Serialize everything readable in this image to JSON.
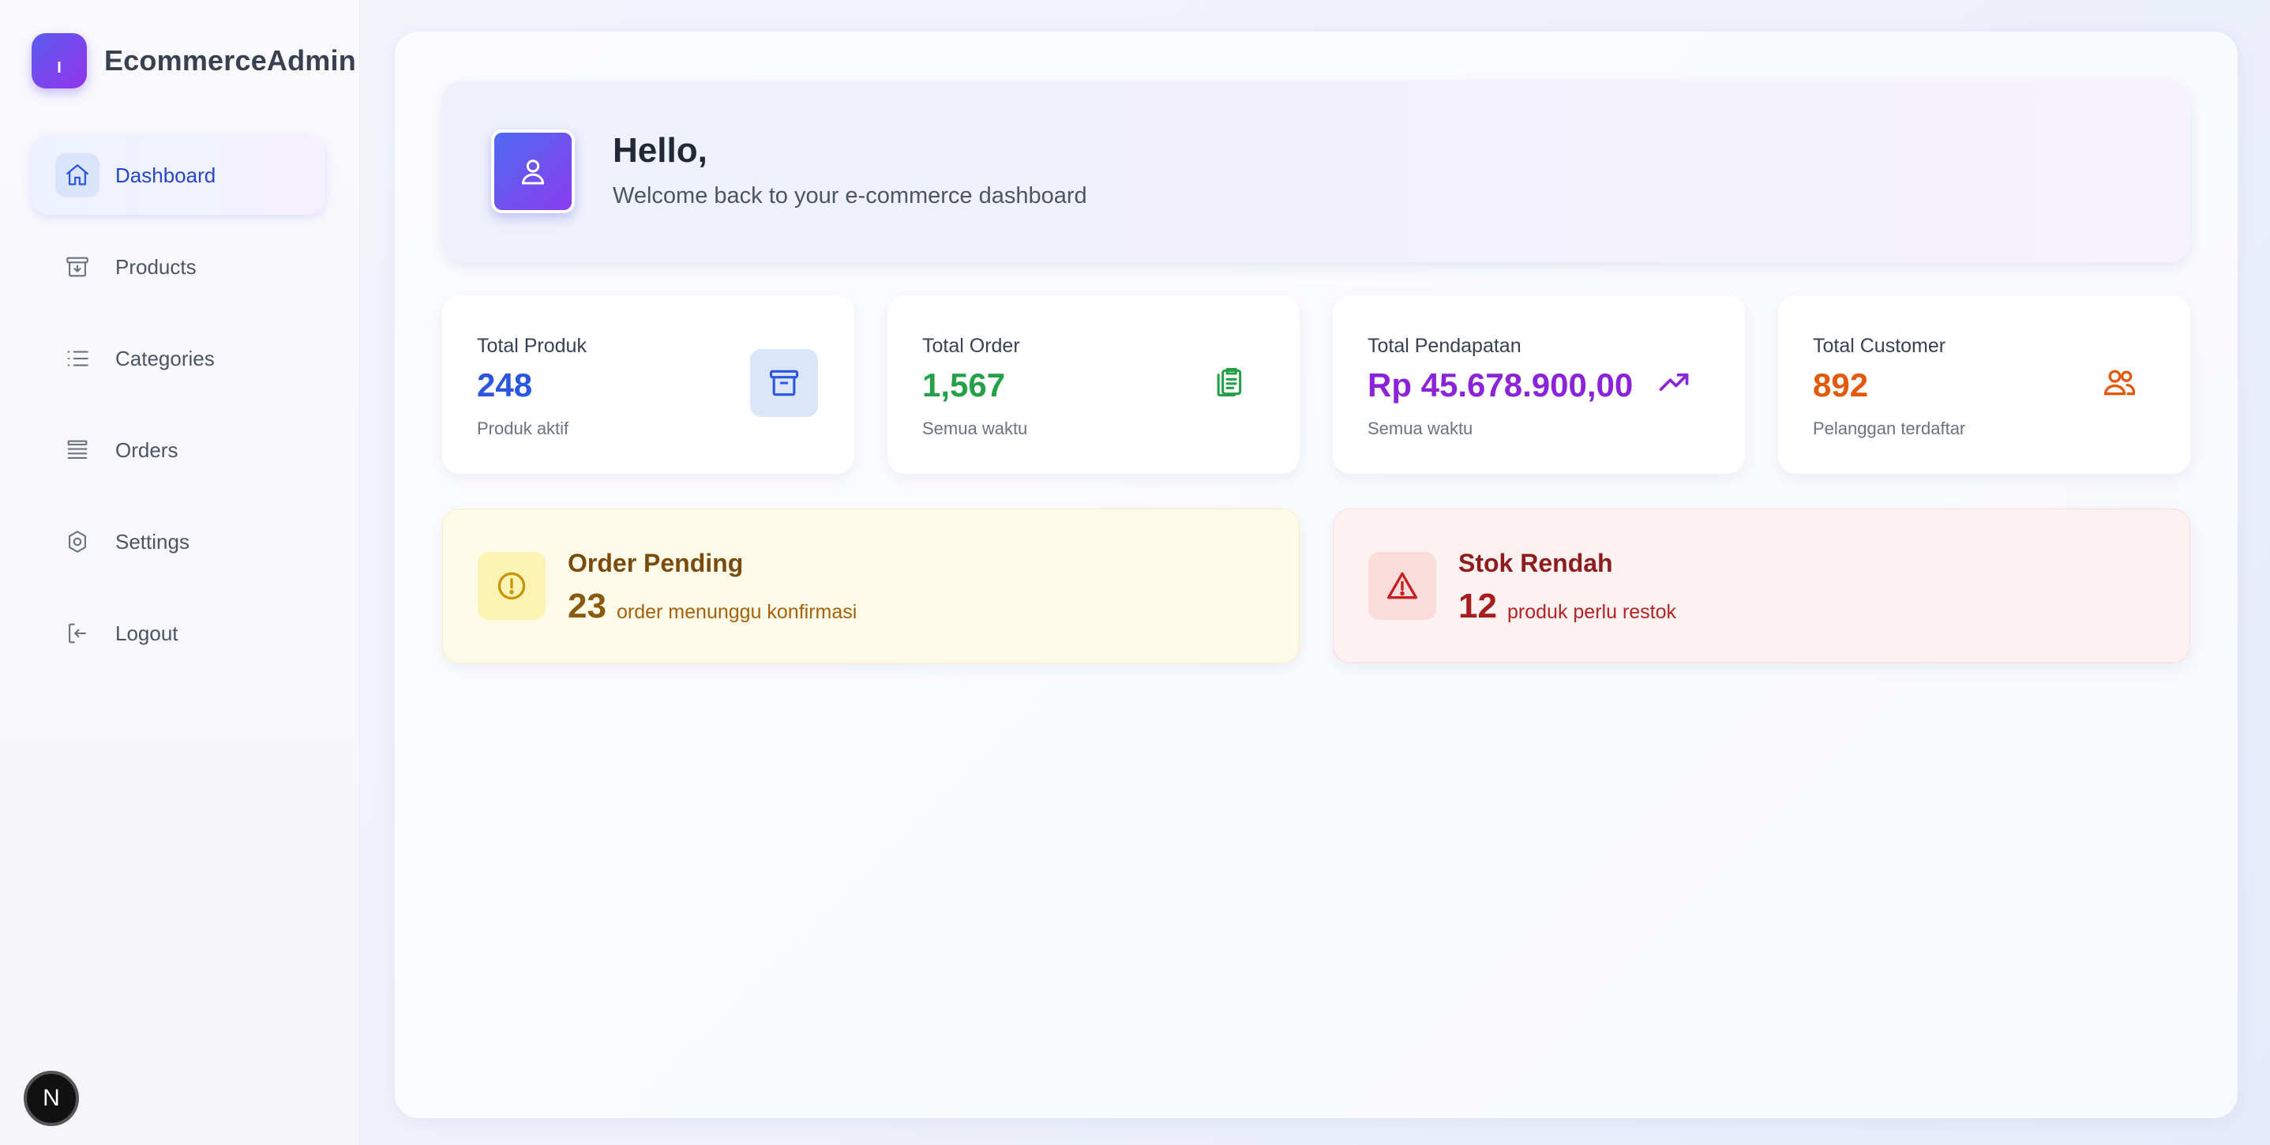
{
  "brand": {
    "logo_letter": "I",
    "name": "EcommerceAdmin",
    "gradient": [
      "#5b5cf0",
      "#9333ea"
    ]
  },
  "sidebar": {
    "items": [
      {
        "label": "Dashboard",
        "icon": "home-icon",
        "active": true
      },
      {
        "label": "Products",
        "icon": "archive-box-icon",
        "active": false
      },
      {
        "label": "Categories",
        "icon": "list-icon",
        "active": false
      },
      {
        "label": "Orders",
        "icon": "queue-list-icon",
        "active": false
      },
      {
        "label": "Settings",
        "icon": "gear-icon",
        "active": false
      },
      {
        "label": "Logout",
        "icon": "logout-icon",
        "active": false
      }
    ]
  },
  "welcome": {
    "title": "Hello,",
    "subtitle": "Welcome back to your e-commerce dashboard",
    "icon": "user-icon"
  },
  "stats": [
    {
      "title": "Total Produk",
      "value": "248",
      "sub": "Produk aktif",
      "color": "#2b56e0",
      "icon": "archive-box-icon"
    },
    {
      "title": "Total Order",
      "value": "1,567",
      "sub": "Semua waktu",
      "color": "#24a148",
      "icon": "clipboard-icon"
    },
    {
      "title": "Total Pendapatan",
      "value": "Rp 45.678.900,00",
      "sub": "Semua waktu",
      "color": "#8b24d9",
      "icon": "trending-up-icon"
    },
    {
      "title": "Total Customer",
      "value": "892",
      "sub": "Pelanggan terdaftar",
      "color": "#e2590c",
      "icon": "users-icon"
    }
  ],
  "alerts": {
    "pending": {
      "title": "Order Pending",
      "count": "23",
      "text": "order menunggu konfirmasi",
      "icon": "exclamation-circle-icon"
    },
    "low_stock": {
      "title": "Stok Rendah",
      "count": "12",
      "text": "produk perlu restok",
      "icon": "warning-triangle-icon"
    }
  },
  "corner_badge": "N"
}
